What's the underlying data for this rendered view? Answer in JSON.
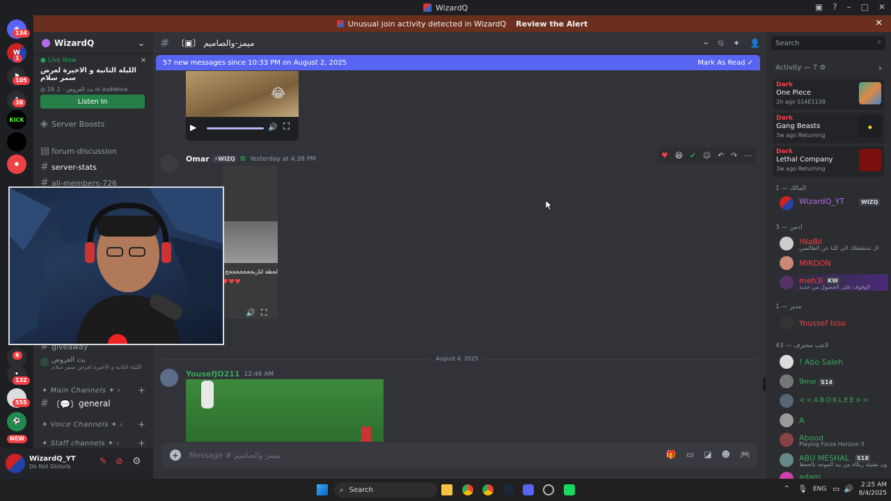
{
  "window": {
    "title": "WizardQ"
  },
  "alert": {
    "text": "Unusual join activity detected in WizardQ",
    "button": "Review the Alert"
  },
  "rail": {
    "badges": [
      "134",
      "1",
      "105",
      "38",
      "6",
      "132",
      "555",
      "NEW"
    ],
    "kick": "KICK"
  },
  "sidebar": {
    "server_name": "WizardQ",
    "live": {
      "label": "Live Now",
      "title": "الليلة الثانية و الاخيرة لعرض سمر سلام",
      "host": "بث العروض",
      "audience": "19 in audience",
      "button": "Listen In"
    },
    "channels": [
      {
        "name": "Server Boosts"
      },
      {
        "name": "forum-discussion"
      },
      {
        "name": "server-stats"
      },
      {
        "name": "all-members-726"
      },
      {
        "name": "giveaway"
      }
    ],
    "stage": {
      "name": "بث العروض",
      "sub": "الليلة الثانية و الاخيرة لعرض سمر سلام"
    },
    "categories": [
      "Main Channels",
      "Voice Channels",
      "Staff channels"
    ],
    "general": "general",
    "user": {
      "name": "WizardQ_YT",
      "status": "Do Not Disturb"
    }
  },
  "chat": {
    "channel_name": "ميمز-والصاميم",
    "new_messages": "57 new messages since 10:33 PM on August 2, 2025",
    "mark_read": "Mark As Read",
    "messages": [
      {
        "author": "Omar",
        "tag": "WIZQ",
        "time": "Yesterday at 4:38 PM",
        "caption": "لحظة لتاريخخخخخخخخ"
      },
      {
        "author": "YousefJO211",
        "time": "12:46 AM"
      }
    ],
    "divider": "August 4, 2025",
    "composer_placeholder": "Message # ميمز-والصاميم"
  },
  "right": {
    "search_placeholder": "Search",
    "activity_header": "Activity — 7",
    "activities": [
      {
        "user": "Dark",
        "game": "One Piece",
        "meta": "2h ago  S14E1138"
      },
      {
        "user": "Dark",
        "game": "Gang Beasts",
        "meta": "3w ago  Returning"
      },
      {
        "user": "Dark",
        "game": "Lethal Company",
        "meta": "3w ago  Returning"
      }
    ],
    "sections": [
      {
        "title": "المالك — 1",
        "members": [
          {
            "name": "WizardQ_YT",
            "tag": "WIZQ",
            "color": "#b46be8"
          }
        ]
      },
      {
        "title": "ادمن — 3",
        "members": [
          {
            "name": "!NaBil",
            "sub": "ال شتقفقلك الي كلنا عن الظالمين",
            "color": "#f23f43"
          },
          {
            "name": "MIRDON",
            "color": "#f23f43"
          },
          {
            "name": "meh3l",
            "tag": "KW",
            "sub": "الوقوف على الحصول من جديد",
            "color": "#f23f43"
          }
        ]
      },
      {
        "title": "مدير — 1",
        "members": [
          {
            "name": "Youssef biso",
            "color": "#f23f43"
          }
        ]
      },
      {
        "title": "لاعب محترف — 43",
        "members": [
          {
            "name": "! Abo Saleh",
            "color": "#3ba55c"
          },
          {
            "name": "9me",
            "tag": "S14",
            "color": "#3ba55c"
          },
          {
            "name": "<<ABOKLEE>>",
            "color": "#3ba55c"
          },
          {
            "name": "A",
            "color": "#3ba55c"
          },
          {
            "name": "Abood",
            "sub": "Playing Forza Horizon 5",
            "color": "#3ba55c"
          },
          {
            "name": "ABU MESHAL",
            "tag": "S18",
            "sub": "ي يهون بشيئة ربكاة من بيد الموجه بالحفظ",
            "color": "#3ba55c"
          },
          {
            "name": "adam",
            "color": "#3ba55c"
          }
        ]
      }
    ]
  },
  "taskbar": {
    "search": "Search",
    "lang": "ENG",
    "time": "2:25 AM",
    "date": "8/4/2025"
  }
}
